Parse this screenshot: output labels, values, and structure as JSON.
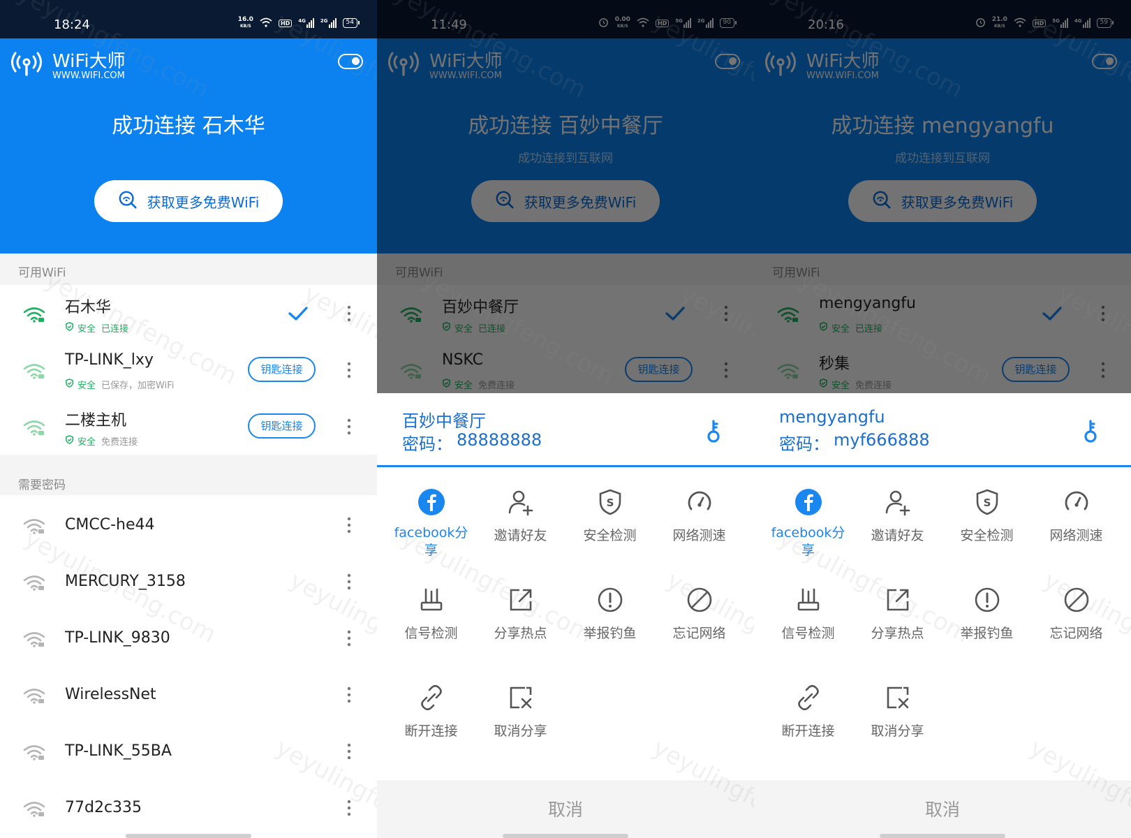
{
  "brand": {
    "name": "WiFi大师",
    "url": "WWW.WIFI.COM"
  },
  "more_wifi_label": "获取更多免费WiFi",
  "section_available": "可用WiFi",
  "section_need_password": "需要密码",
  "badge_safe": "安全",
  "status_connected": "已连接",
  "key_connect_label": "钥匙连接",
  "watermark": "yeyulingfeng.com",
  "colors": {
    "primary": "#0b82f0",
    "accent": "#1a86f0",
    "safe_green": "#1db260",
    "status_bar": "#0a1a33"
  },
  "screens": [
    {
      "status": {
        "time": "18:24",
        "speed": "16.0",
        "speed_unit": "KB/S",
        "hd": "HD",
        "net1": "4G",
        "net2": "2G",
        "battery": "54"
      },
      "title": "成功连接 石木华",
      "subtitle": "",
      "available": [
        {
          "name": "石木华",
          "status": "已连接",
          "connected": true
        },
        {
          "name": "TP-LINK_lxy",
          "status": "已保存，加密WiFi",
          "connected": false
        },
        {
          "name": "二楼主机",
          "status": "免费连接",
          "connected": false
        }
      ],
      "need_password": [
        {
          "name": "CMCC-he44"
        },
        {
          "name": "MERCURY_3158"
        },
        {
          "name": "TP-LINK_9830"
        },
        {
          "name": "WirelessNet"
        },
        {
          "name": "TP-LINK_55BA"
        },
        {
          "name": "77d2c335"
        }
      ]
    },
    {
      "status": {
        "time": "11:49",
        "speed": "0.00",
        "speed_unit": "KB/S",
        "hd": "HD",
        "net1": "5G",
        "net2": "2G",
        "battery": "90"
      },
      "title": "成功连接 百妙中餐厅",
      "subtitle": "成功连接到互联网",
      "available": [
        {
          "name": "百妙中餐厅",
          "status": "已连接",
          "connected": true
        },
        {
          "name": "NSKC",
          "status": "免费连接",
          "connected": false
        }
      ],
      "sheet": {
        "ssid": "百妙中餐厅",
        "password_label": "密码：",
        "password": "88888888",
        "cancel": "取消"
      }
    },
    {
      "status": {
        "time": "20:16",
        "speed": "21.0",
        "speed_unit": "KB/S",
        "hd": "HD",
        "net1": "5G",
        "net2": "4G",
        "battery": "59"
      },
      "title": "成功连接 mengyangfu",
      "subtitle": "成功连接到互联网",
      "available": [
        {
          "name": "mengyangfu",
          "status": "已连接",
          "connected": true
        },
        {
          "name": "秒集",
          "status": "免费连接",
          "connected": false
        }
      ],
      "sheet": {
        "ssid": "mengyangfu",
        "password_label": "密码：",
        "password": "myf666888",
        "cancel": "取消"
      }
    }
  ],
  "actions": [
    {
      "label": "facebook分\n享",
      "icon": "facebook-icon",
      "highlight": true
    },
    {
      "label": "邀请好友",
      "icon": "add-user-icon"
    },
    {
      "label": "安全检测",
      "icon": "shield-icon"
    },
    {
      "label": "网络测速",
      "icon": "speedometer-icon"
    },
    {
      "label": "信号检测",
      "icon": "router-icon"
    },
    {
      "label": "分享热点",
      "icon": "share-icon"
    },
    {
      "label": "举报钓鱼",
      "icon": "alert-icon"
    },
    {
      "label": "忘记网络",
      "icon": "forbid-icon"
    },
    {
      "label": "断开连接",
      "icon": "unlink-icon"
    },
    {
      "label": "取消分享",
      "icon": "cancel-share-icon"
    }
  ]
}
